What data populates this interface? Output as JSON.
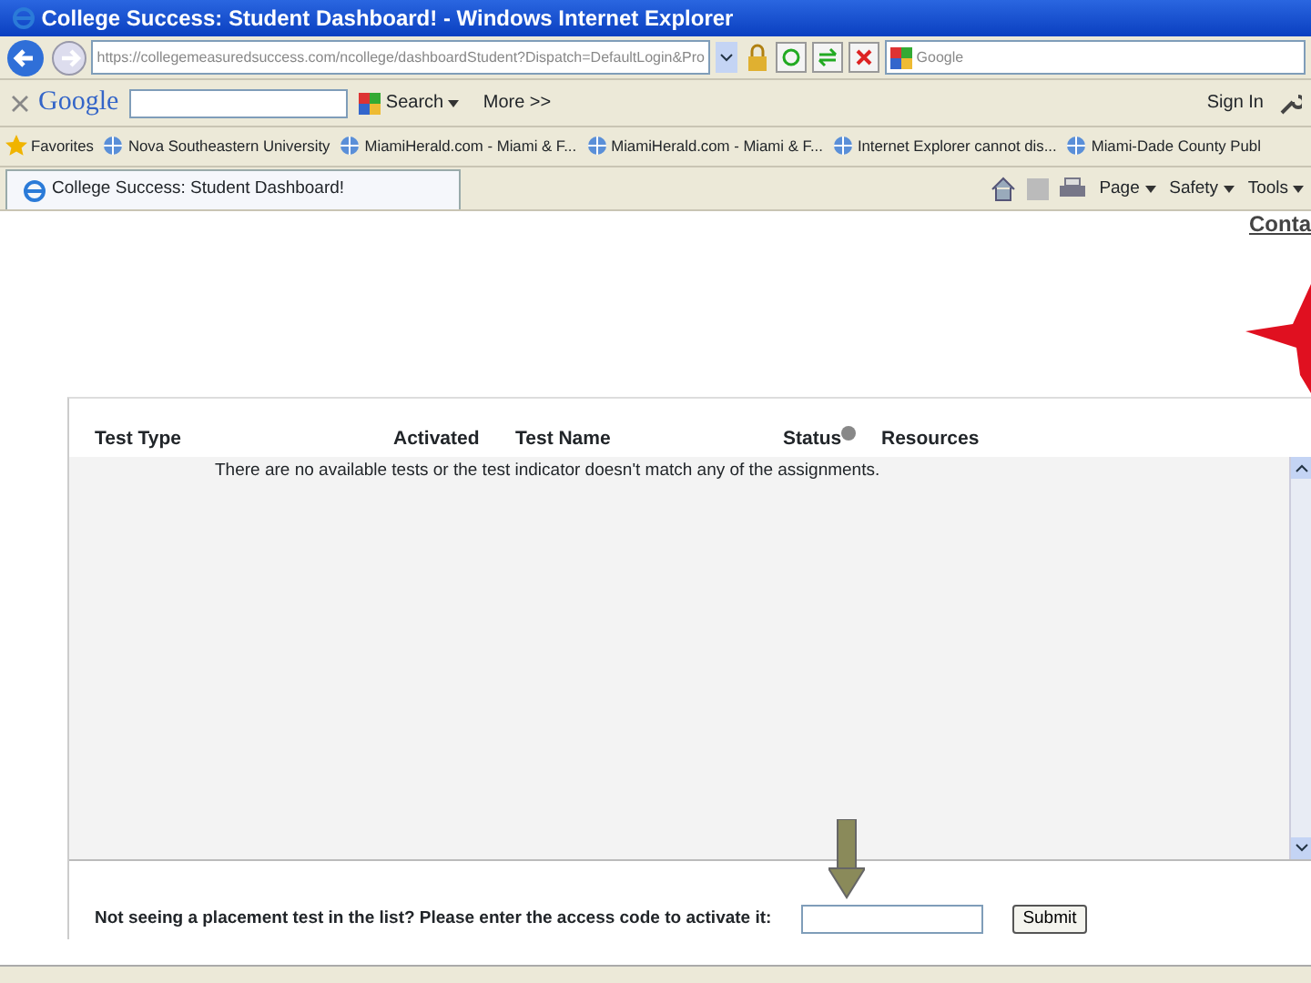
{
  "window": {
    "title": "College Success: Student Dashboard! - Windows Internet Explorer"
  },
  "address_bar": {
    "url": "https://collegemeasuredsuccess.com/ncollege/dashboardStudent?Dispatch=DefaultLogin&Pro",
    "search_placeholder": "Google"
  },
  "google_toolbar": {
    "logo": "Google",
    "search_button": "Search",
    "more": "More >>",
    "sign_in": "Sign In"
  },
  "favorites": [
    {
      "label": "Favorites",
      "kind": "menu"
    },
    {
      "label": "Nova Southeastern University",
      "kind": "link"
    },
    {
      "label": "MiamiHerald.com - Miami & F...",
      "kind": "link"
    },
    {
      "label": "MiamiHerald.com - Miami & F...",
      "kind": "link"
    },
    {
      "label": "Internet Explorer cannot dis...",
      "kind": "link"
    },
    {
      "label": "Miami-Dade County Publ",
      "kind": "link"
    }
  ],
  "tab": {
    "label": "College Success: Student Dashboard!",
    "selected": true
  },
  "command_bar": [
    "Page",
    "Safety",
    "Tools"
  ],
  "page": {
    "top_link": "Conta",
    "table": {
      "columns": [
        "Test Type",
        "Activated",
        "Test Name",
        "Status",
        "Resources"
      ],
      "empty_message": "There are no available tests or the test indicator doesn't match any of the assignments."
    },
    "access_code": {
      "prompt": "Not seeing a placement test in the list? Please enter the access code to activate it:",
      "button": "Submit"
    }
  }
}
